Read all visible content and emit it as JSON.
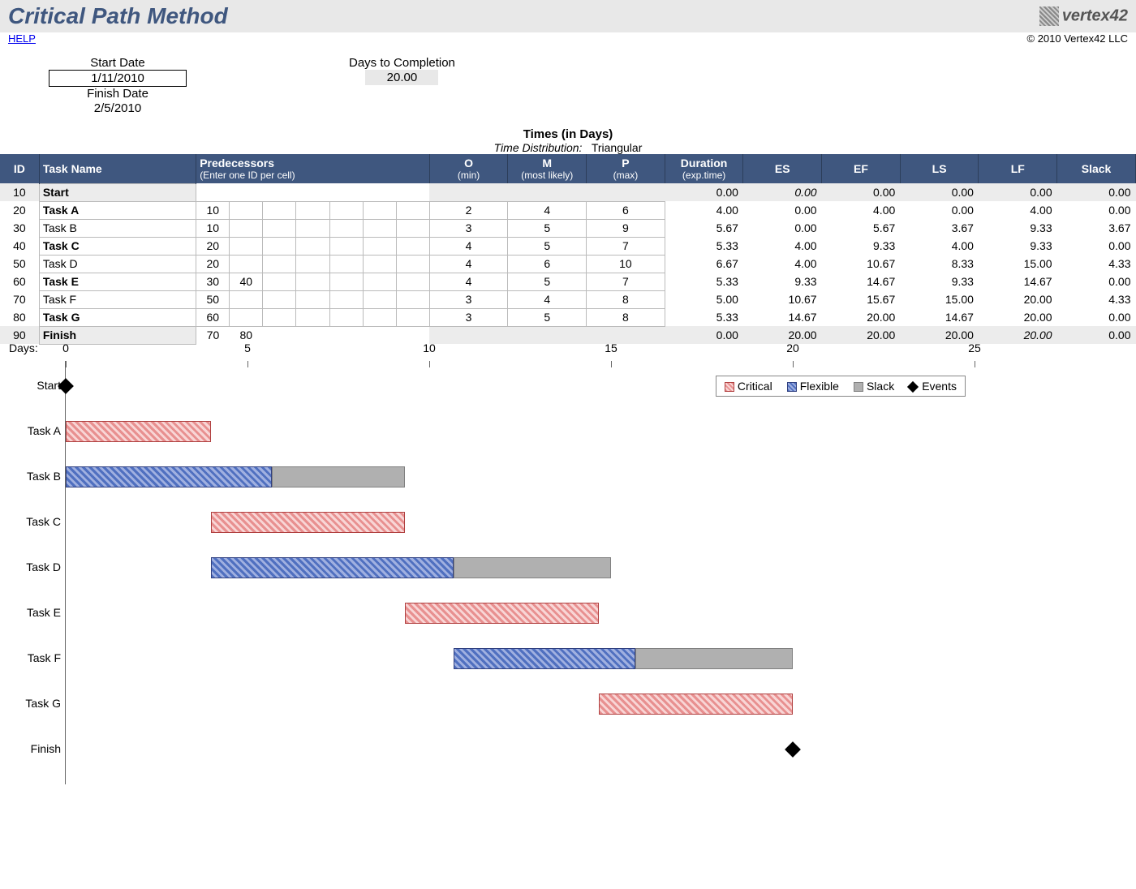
{
  "header": {
    "title": "Critical Path Method",
    "logo_text": "vertex42",
    "help_label": "HELP",
    "copyright": "© 2010 Vertex42 LLC"
  },
  "info": {
    "start_date_label": "Start Date",
    "start_date_value": "1/11/2010",
    "finish_date_label": "Finish Date",
    "finish_date_value": "2/5/2010",
    "days_to_completion_label": "Days to Completion",
    "days_to_completion_value": "20.00"
  },
  "times": {
    "heading": "Times (in Days)",
    "dist_label": "Time Distribution:",
    "dist_value": "Triangular"
  },
  "columns": {
    "id": "ID",
    "task_name": "Task Name",
    "predecessors": "Predecessors",
    "predecessors_sub": "(Enter one ID per cell)",
    "O": "O",
    "O_sub": "(min)",
    "M": "M",
    "M_sub": "(most likely)",
    "P": "P",
    "P_sub": "(max)",
    "duration": "Duration",
    "duration_sub": "(exp.time)",
    "ES": "ES",
    "EF": "EF",
    "LS": "LS",
    "LF": "LF",
    "slack": "Slack"
  },
  "rows": [
    {
      "id": "10",
      "name": "Start",
      "bold": true,
      "shaded": true,
      "preds": [
        "",
        "",
        "",
        "",
        "",
        "",
        ""
      ],
      "O": "",
      "M": "",
      "P": "",
      "dur": "0.00",
      "es": "0.00",
      "ef": "0.00",
      "ls": "0.00",
      "lf": "0.00",
      "slack": "0.00",
      "es_italic": true,
      "nobox": true
    },
    {
      "id": "20",
      "name": "Task A",
      "bold": true,
      "preds": [
        "10",
        "",
        "",
        "",
        "",
        "",
        ""
      ],
      "O": "2",
      "M": "4",
      "P": "6",
      "dur": "4.00",
      "es": "0.00",
      "ef": "4.00",
      "ls": "0.00",
      "lf": "4.00",
      "slack": "0.00"
    },
    {
      "id": "30",
      "name": "Task B",
      "preds": [
        "10",
        "",
        "",
        "",
        "",
        "",
        ""
      ],
      "O": "3",
      "M": "5",
      "P": "9",
      "dur": "5.67",
      "es": "0.00",
      "ef": "5.67",
      "ls": "3.67",
      "lf": "9.33",
      "slack": "3.67"
    },
    {
      "id": "40",
      "name": "Task C",
      "bold": true,
      "preds": [
        "20",
        "",
        "",
        "",
        "",
        "",
        ""
      ],
      "O": "4",
      "M": "5",
      "P": "7",
      "dur": "5.33",
      "es": "4.00",
      "ef": "9.33",
      "ls": "4.00",
      "lf": "9.33",
      "slack": "0.00"
    },
    {
      "id": "50",
      "name": "Task D",
      "preds": [
        "20",
        "",
        "",
        "",
        "",
        "",
        ""
      ],
      "O": "4",
      "M": "6",
      "P": "10",
      "dur": "6.67",
      "es": "4.00",
      "ef": "10.67",
      "ls": "8.33",
      "lf": "15.00",
      "slack": "4.33"
    },
    {
      "id": "60",
      "name": "Task E",
      "bold": true,
      "preds": [
        "30",
        "40",
        "",
        "",
        "",
        "",
        ""
      ],
      "O": "4",
      "M": "5",
      "P": "7",
      "dur": "5.33",
      "es": "9.33",
      "ef": "14.67",
      "ls": "9.33",
      "lf": "14.67",
      "slack": "0.00"
    },
    {
      "id": "70",
      "name": "Task F",
      "preds": [
        "50",
        "",
        "",
        "",
        "",
        "",
        ""
      ],
      "O": "3",
      "M": "4",
      "P": "8",
      "dur": "5.00",
      "es": "10.67",
      "ef": "15.67",
      "ls": "15.00",
      "lf": "20.00",
      "slack": "4.33"
    },
    {
      "id": "80",
      "name": "Task G",
      "bold": true,
      "preds": [
        "60",
        "",
        "",
        "",
        "",
        "",
        ""
      ],
      "O": "3",
      "M": "5",
      "P": "8",
      "dur": "5.33",
      "es": "14.67",
      "ef": "20.00",
      "ls": "14.67",
      "lf": "20.00",
      "slack": "0.00"
    },
    {
      "id": "90",
      "name": "Finish",
      "bold": true,
      "shaded": true,
      "preds": [
        "70",
        "80",
        "",
        "",
        "",
        "",
        ""
      ],
      "O": "",
      "M": "",
      "P": "",
      "dur": "0.00",
      "es": "20.00",
      "ef": "20.00",
      "ls": "20.00",
      "lf": "20.00",
      "slack": "0.00",
      "lf_italic": true,
      "nobox": true
    }
  ],
  "chart_data": {
    "type": "bar",
    "xlabel": "Days:",
    "xlim": [
      0,
      25
    ],
    "ticks": [
      0,
      5,
      10,
      15,
      20,
      25
    ],
    "legend": {
      "critical": "Critical",
      "flexible": "Flexible",
      "slack": "Slack",
      "events": "Events"
    },
    "tasks": [
      {
        "name": "Start",
        "type": "event",
        "at": 0
      },
      {
        "name": "Task A",
        "type": "critical",
        "es": 0,
        "ef": 4
      },
      {
        "name": "Task B",
        "type": "flexible",
        "es": 0,
        "ef": 5.67,
        "slack_end": 9.33
      },
      {
        "name": "Task C",
        "type": "critical",
        "es": 4,
        "ef": 9.33
      },
      {
        "name": "Task D",
        "type": "flexible",
        "es": 4,
        "ef": 10.67,
        "slack_end": 15
      },
      {
        "name": "Task E",
        "type": "critical",
        "es": 9.33,
        "ef": 14.67
      },
      {
        "name": "Task F",
        "type": "flexible",
        "es": 10.67,
        "ef": 15.67,
        "slack_end": 20
      },
      {
        "name": "Task G",
        "type": "critical",
        "es": 14.67,
        "ef": 20
      },
      {
        "name": "Finish",
        "type": "event",
        "at": 20
      }
    ]
  }
}
